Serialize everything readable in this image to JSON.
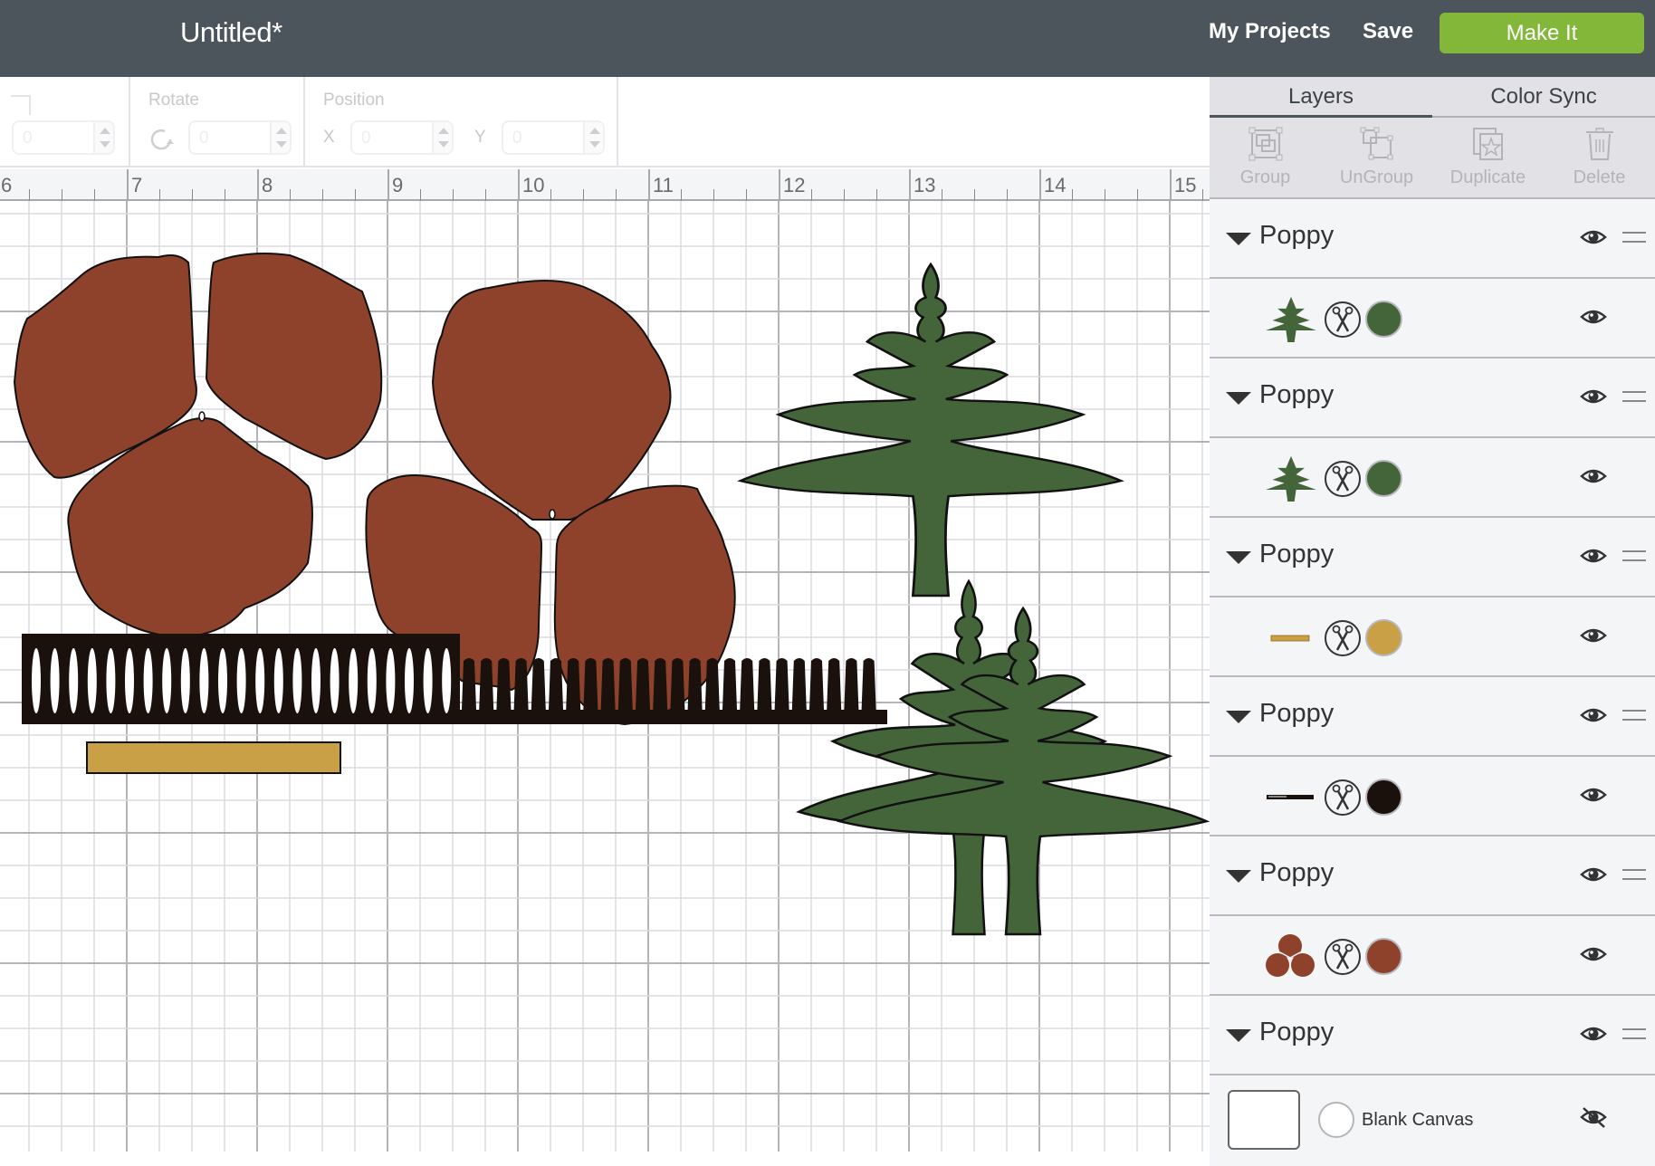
{
  "header": {
    "title": "Untitled*",
    "my_projects": "My Projects",
    "save": "Save",
    "make_it": "Make It"
  },
  "toolbar": {
    "size_value": "0",
    "rotate_label": "Rotate",
    "rotate_value": "0",
    "position_label": "Position",
    "x_label": "X",
    "x_value": "0",
    "y_label": "Y",
    "y_value": "0"
  },
  "ruler": {
    "unit": "inches",
    "labels": [
      "6",
      "7",
      "8",
      "9",
      "10",
      "11",
      "12",
      "13",
      "14",
      "15"
    ]
  },
  "panel": {
    "tabs": [
      {
        "label": "Layers",
        "active": true
      },
      {
        "label": "Color Sync",
        "active": false
      }
    ],
    "actions": [
      {
        "label": "Group",
        "icon": "group-icon"
      },
      {
        "label": "UnGroup",
        "icon": "ungroup-icon"
      },
      {
        "label": "Duplicate",
        "icon": "duplicate-icon"
      },
      {
        "label": "Delete",
        "icon": "trash-icon"
      }
    ],
    "layers": [
      {
        "group": "Poppy",
        "child": {
          "thumb": "leaf",
          "operation": "cut",
          "color": "#44643a",
          "visible": true
        }
      },
      {
        "group": "Poppy",
        "child": {
          "thumb": "leaf",
          "operation": "cut",
          "color": "#44643a",
          "visible": true
        }
      },
      {
        "group": "Poppy",
        "child": {
          "thumb": "strip",
          "operation": "cut",
          "color": "#c9a046",
          "visible": true
        }
      },
      {
        "group": "Poppy",
        "child": {
          "thumb": "fringe",
          "operation": "cut",
          "color": "#1a110c",
          "visible": true
        }
      },
      {
        "group": "Poppy",
        "child": {
          "thumb": "petals",
          "operation": "cut",
          "color": "#8e422b",
          "visible": true
        }
      },
      {
        "group": "Poppy"
      }
    ],
    "blank_canvas": {
      "label": "Blank Canvas",
      "visible": false
    }
  },
  "colors": {
    "header_bg": "#4d555c",
    "make_it": "#83b73a",
    "petal": "#8e422b",
    "leaf": "#44643a",
    "fringe": "#1a110c",
    "strip": "#c9a046"
  }
}
